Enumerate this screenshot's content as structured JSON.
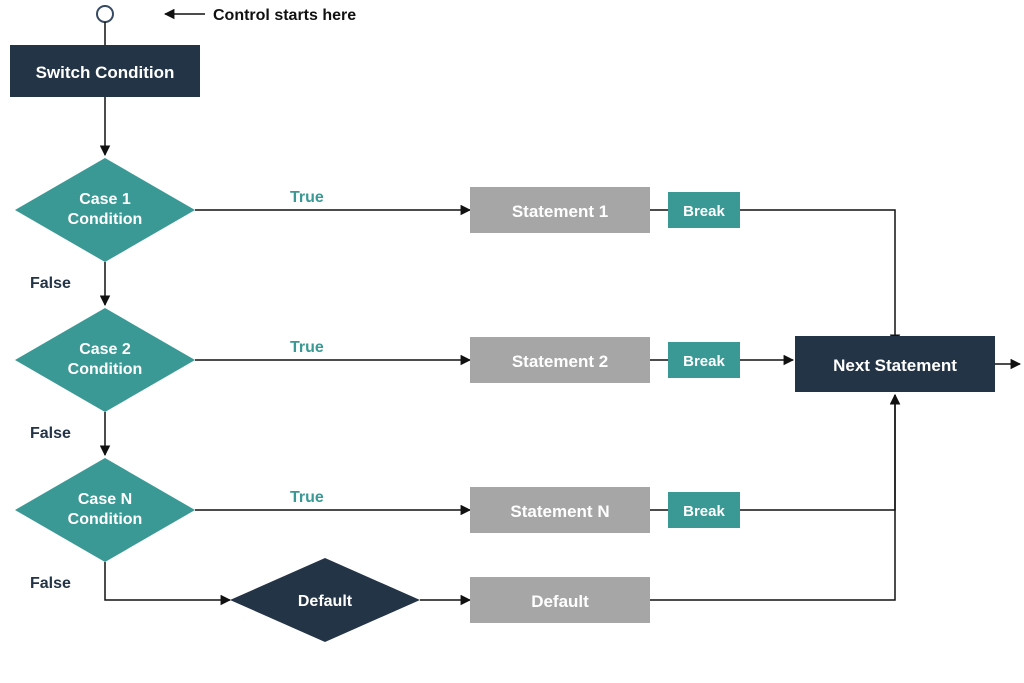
{
  "annotation": "Control starts here",
  "switch_box": "Switch Condition",
  "cases": [
    {
      "cond_line1": "Case 1",
      "cond_line2": "Condition",
      "true": "True",
      "false": "False",
      "stmt": "Statement 1",
      "brk": "Break"
    },
    {
      "cond_line1": "Case 2",
      "cond_line2": "Condition",
      "true": "True",
      "false": "False",
      "stmt": "Statement 2",
      "brk": "Break"
    },
    {
      "cond_line1": "Case N",
      "cond_line2": "Condition",
      "true": "True",
      "false": "False",
      "stmt": "Statement N",
      "brk": "Break"
    }
  ],
  "default_diamond": "Default",
  "default_stmt": "Default",
  "next": "Next Statement"
}
